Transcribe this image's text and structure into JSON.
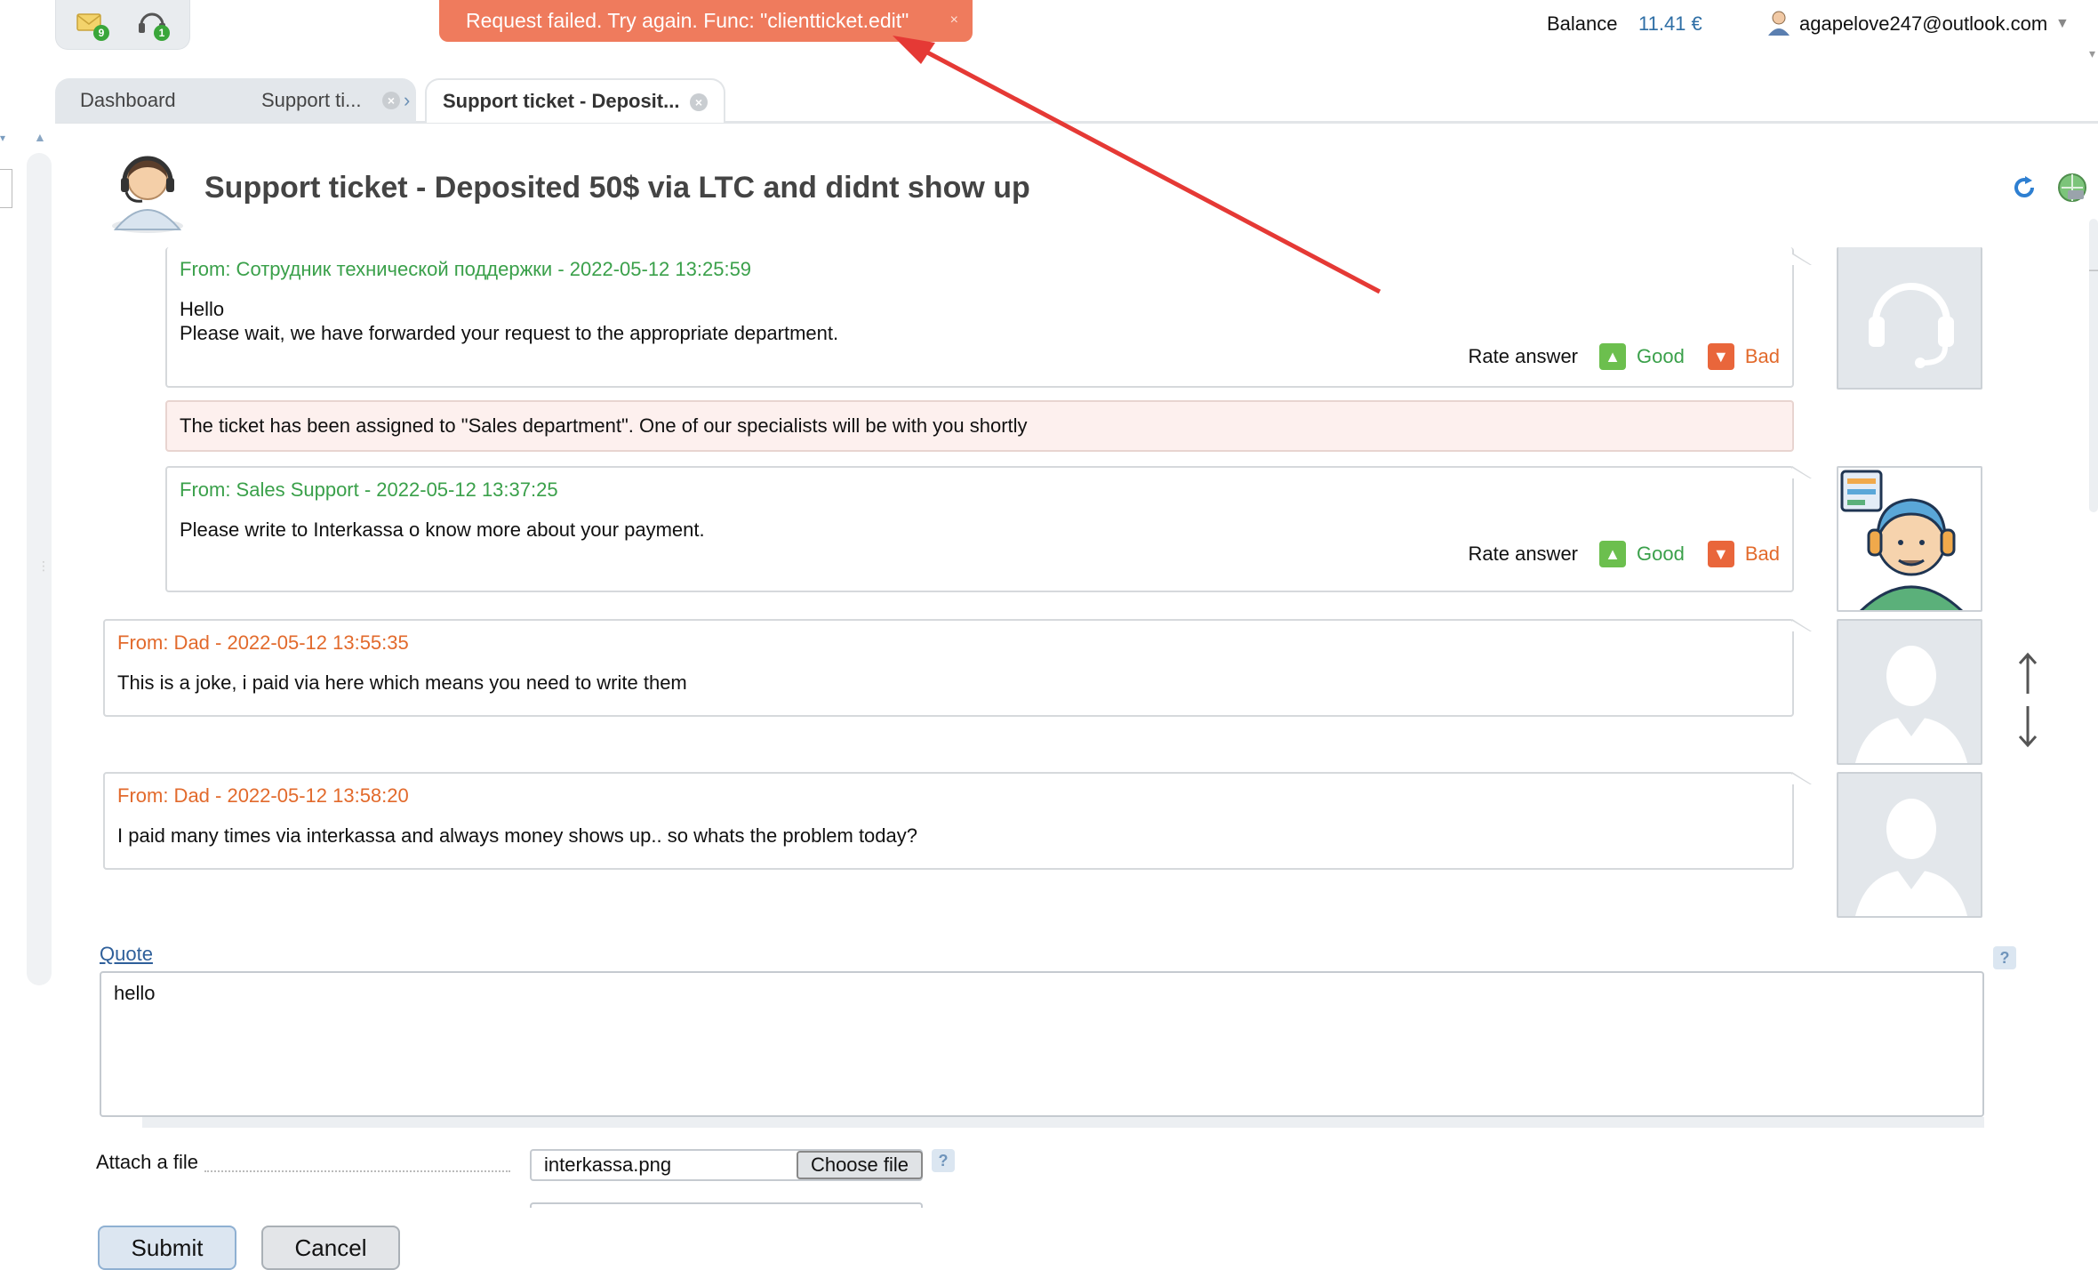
{
  "top_widgets": {
    "messages_badge": "9",
    "support_badge": "1"
  },
  "toast": {
    "message": "Request failed. Try again. Func: \"clientticket.edit\"",
    "close": "×"
  },
  "account": {
    "balance_label": "Balance",
    "balance_value": "11.41 €",
    "email": "agapelove247@outlook.com"
  },
  "tabs": [
    {
      "label": "Dashboard"
    },
    {
      "label": "Support ti..."
    },
    {
      "label": "Support ticket - Deposit..."
    }
  ],
  "page": {
    "title": "Support ticket - Deposited 50$ via LTC and didnt show up"
  },
  "messages": [
    {
      "from": "From: Сотрудник технической поддержки - 2022-05-12 13:25:59",
      "body_line1": "Hello",
      "body_line2": "Please wait, we have forwarded your request to the appropriate department."
    },
    {
      "from": "From: Sales Support - 2022-05-12 13:37:25",
      "body_line1": "Please write to Interkassa o know more about your payment."
    },
    {
      "from": "From: Dad - 2022-05-12 13:55:35",
      "body_line1": "This is a joke, i paid via here which means you need to write them"
    },
    {
      "from": "From: Dad - 2022-05-12 13:58:20",
      "body_line1": "I paid many times via interkassa and always money shows up.. so whats the problem today?"
    }
  ],
  "assignment_note": "The ticket has been assigned to \"Sales department\". One of our specialists will be with you shortly",
  "rating": {
    "label": "Rate answer",
    "good": "Good",
    "bad": "Bad"
  },
  "reply": {
    "quote_link": "Quote",
    "text": "hello",
    "help": "?"
  },
  "attachment": {
    "label": "Attach a file",
    "file_name": "interkassa.png",
    "choose_button": "Choose file",
    "help": "?"
  },
  "actions": {
    "submit": "Submit",
    "cancel": "Cancel"
  },
  "colors": {
    "toast_bg": "#ef7b5d",
    "staff_name": "#3aa04a",
    "client_name": "#e26a2c",
    "annotation_arrow": "#e53935"
  }
}
